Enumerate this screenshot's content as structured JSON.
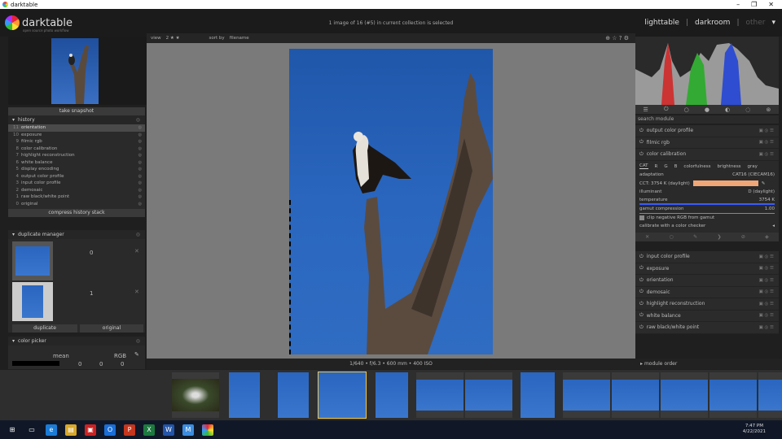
{
  "window": {
    "title": "darktable",
    "controls": [
      "–",
      "❐",
      "✕"
    ]
  },
  "brand": {
    "name": "darktable",
    "subtitle": "open source photo workflow"
  },
  "top_status": "1 image of 16 (#5) in current collection is selected",
  "views": {
    "lighttable": "lighttable",
    "darkroom": "darkroom",
    "other": "other",
    "separator": "|"
  },
  "left": {
    "snapshot_button": "take snapshot",
    "history_title": "history",
    "history": [
      {
        "n": "11",
        "label": "orientation",
        "sel": true
      },
      {
        "n": "10",
        "label": "exposure"
      },
      {
        "n": "9",
        "label": "filmic rgb"
      },
      {
        "n": "8",
        "label": "color calibration"
      },
      {
        "n": "7",
        "label": "highlight reconstruction"
      },
      {
        "n": "6",
        "label": "white balance"
      },
      {
        "n": "5",
        "label": "display encoding"
      },
      {
        "n": "4",
        "label": "output color profile"
      },
      {
        "n": "3",
        "label": "input color profile"
      },
      {
        "n": "2",
        "label": "demosaic"
      },
      {
        "n": "1",
        "label": "raw black/white point"
      },
      {
        "n": "0",
        "label": "original"
      }
    ],
    "compress_button": "compress history stack",
    "duplicate_title": "duplicate manager",
    "dup_numbers": [
      "0",
      "1"
    ],
    "dup_buttons": {
      "duplicate": "duplicate",
      "original": "original"
    },
    "picker_title": "color picker",
    "picker_mean": "mean",
    "picker_rgb": "RGB",
    "picker_values": [
      "0",
      "0",
      "0"
    ]
  },
  "center": {
    "view_label": "view",
    "view_value": "2 ★ ★",
    "sort_label": "sort by",
    "sort_value": "filename",
    "exif": "1/640 • f/6.3 • 600 mm • 400 ISO"
  },
  "right": {
    "search_placeholder": "search module",
    "modules_top": [
      "output color profile",
      "filmic rgb",
      "color calibration"
    ],
    "cc_tabs": [
      "CAT",
      "R",
      "G",
      "B",
      "colorfulness",
      "brightness",
      "gray"
    ],
    "cc_adaptation": {
      "label": "adaptation",
      "value": "CAT16 (CIECAM16)"
    },
    "cc_cct": "CCT: 3754 K (daylight)",
    "cc_illuminant": {
      "label": "illuminant",
      "value": "D (daylight)"
    },
    "cc_temperature": {
      "label": "temperature",
      "value": "3754 K"
    },
    "cc_gamut": {
      "label": "gamut compression",
      "value": "1.00"
    },
    "cc_clip": "clip negative RGB from gamut",
    "cc_calibrate": "calibrate with a color checker",
    "modules_bottom": [
      "input color profile",
      "exposure",
      "orientation",
      "demosaic",
      "highlight reconstruction",
      "white balance",
      "raw black/white point"
    ],
    "module_order": "module order"
  },
  "taskbar": {
    "time": "7:47 PM",
    "date": "4/22/2021"
  },
  "colors": {
    "cct_swatch": "#f0a677",
    "selection": "#f2c94c",
    "sky": "#2a66be"
  }
}
